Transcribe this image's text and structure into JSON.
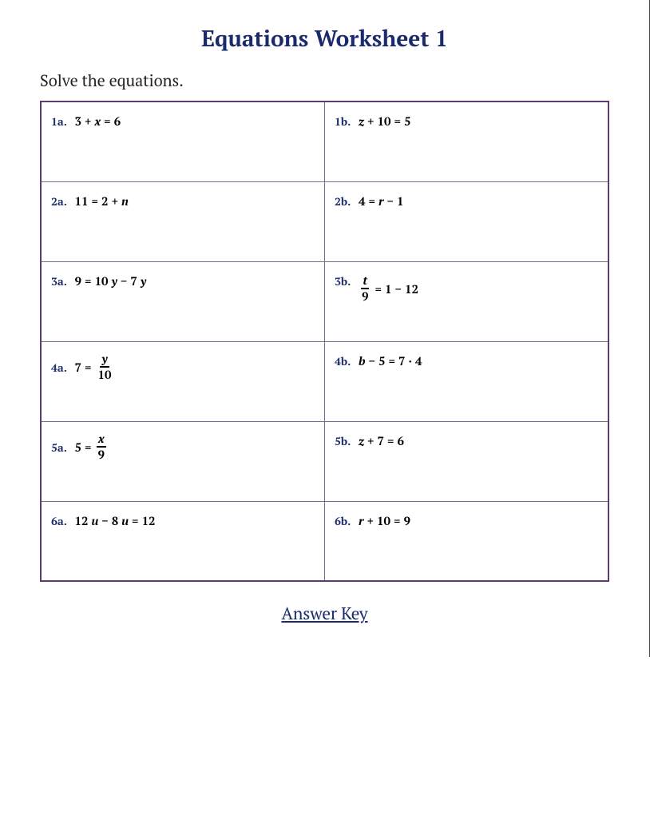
{
  "title": "Equations Worksheet 1",
  "instructions": "Solve the equations.",
  "answerKey": "Answer Key",
  "problems": {
    "p1a": {
      "label": "1a.",
      "pre": "3 + ",
      "var": "x",
      "post": "   =   6"
    },
    "p1b": {
      "label": "1b.",
      "pre": "",
      "var": "z",
      "post": " + 10   =   5"
    },
    "p2a": {
      "label": "2a.",
      "pre": "11   =   2 + ",
      "var": "n",
      "post": ""
    },
    "p2b": {
      "label": "2b.",
      "pre": "4   =   ",
      "var": "r",
      "post": " − 1"
    },
    "p3a": {
      "label": "3a.",
      "pre": "9   =   10",
      "var1": "y",
      "mid": " − 7",
      "var2": "y"
    },
    "p3b": {
      "label": "3b.",
      "fracNum": "t",
      "fracNumVar": true,
      "fracDen": "9",
      "rhs": "   =   1 − 12"
    },
    "p4a": {
      "label": "4a.",
      "lhs": "7   =   ",
      "fracNum": "y",
      "fracNumVar": true,
      "fracDen": "10"
    },
    "p4b": {
      "label": "4b.",
      "pre": "",
      "var": "b",
      "post": " − 5   =   7 · 4"
    },
    "p5a": {
      "label": "5a.",
      "lhs": "5   =   ",
      "fracNum": "x",
      "fracNumVar": true,
      "fracDen": "9"
    },
    "p5b": {
      "label": "5b.",
      "pre": "",
      "var": "z",
      "post": " + 7   =   6"
    },
    "p6a": {
      "label": "6a.",
      "pre": "12",
      "var1": "u",
      "mid": " − 8",
      "var2": "u",
      "post": "   =   12"
    },
    "p6b": {
      "label": "6b.",
      "pre": "",
      "var": "r",
      "post": " + 10   =   9"
    }
  }
}
